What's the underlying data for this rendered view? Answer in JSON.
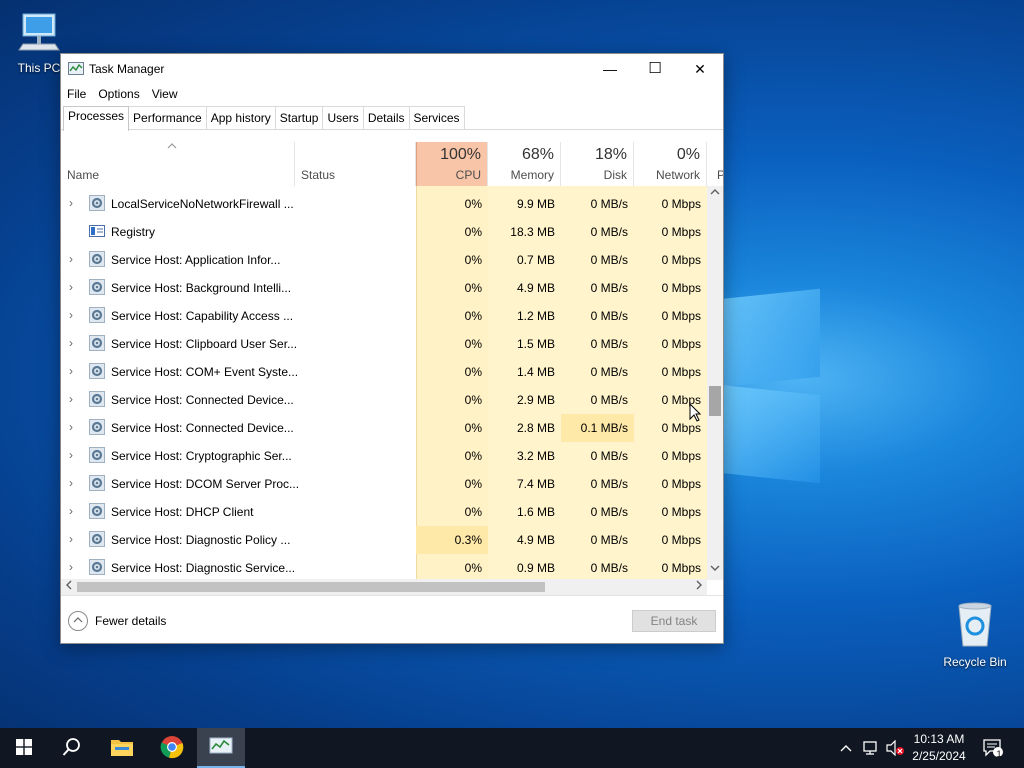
{
  "desktop": {
    "icons": [
      {
        "label": "This PC"
      },
      {
        "label": "Recycle Bin"
      }
    ]
  },
  "window": {
    "title": "Task Manager",
    "controls": {
      "minimize": "—",
      "maximize": "☐",
      "close": "✕"
    }
  },
  "menu": [
    "File",
    "Options",
    "View"
  ],
  "tabs": [
    "Processes",
    "Performance",
    "App history",
    "Startup",
    "Users",
    "Details",
    "Services"
  ],
  "active_tab": "Processes",
  "columns": {
    "name": "Name",
    "status": "Status",
    "cpu": {
      "label": "CPU",
      "pct": "100%"
    },
    "memory": {
      "label": "Memory",
      "pct": "68%"
    },
    "disk": {
      "label": "Disk",
      "pct": "18%"
    },
    "network": {
      "label": "Network",
      "pct": "0%"
    },
    "next": "P"
  },
  "rows": [
    {
      "expand": "›",
      "icon": "gear-icon",
      "name": "LocalServiceNoNetworkFirewall ...",
      "cpu": "0%",
      "mem": "9.9 MB",
      "disk": "0 MB/s",
      "net": "0 Mbps"
    },
    {
      "expand": "",
      "icon": "registry-icon",
      "name": "Registry",
      "cpu": "0%",
      "mem": "18.3 MB",
      "disk": "0 MB/s",
      "net": "0 Mbps"
    },
    {
      "expand": "›",
      "icon": "gear-icon",
      "name": "Service Host: Application Infor...",
      "cpu": "0%",
      "mem": "0.7 MB",
      "disk": "0 MB/s",
      "net": "0 Mbps"
    },
    {
      "expand": "›",
      "icon": "gear-icon",
      "name": "Service Host: Background Intelli...",
      "cpu": "0%",
      "mem": "4.9 MB",
      "disk": "0 MB/s",
      "net": "0 Mbps"
    },
    {
      "expand": "›",
      "icon": "gear-icon",
      "name": "Service Host: Capability Access ...",
      "cpu": "0%",
      "mem": "1.2 MB",
      "disk": "0 MB/s",
      "net": "0 Mbps"
    },
    {
      "expand": "›",
      "icon": "gear-icon",
      "name": "Service Host: Clipboard User Ser...",
      "cpu": "0%",
      "mem": "1.5 MB",
      "disk": "0 MB/s",
      "net": "0 Mbps"
    },
    {
      "expand": "›",
      "icon": "gear-icon",
      "name": "Service Host: COM+ Event Syste...",
      "cpu": "0%",
      "mem": "1.4 MB",
      "disk": "0 MB/s",
      "net": "0 Mbps"
    },
    {
      "expand": "›",
      "icon": "gear-icon",
      "name": "Service Host: Connected Device...",
      "cpu": "0%",
      "mem": "2.9 MB",
      "disk": "0 MB/s",
      "net": "0 Mbps"
    },
    {
      "expand": "›",
      "icon": "gear-icon",
      "name": "Service Host: Connected Device...",
      "cpu": "0%",
      "mem": "2.8 MB",
      "disk": "0.1 MB/s",
      "net": "0 Mbps",
      "disk_hot": true
    },
    {
      "expand": "›",
      "icon": "gear-icon",
      "name": "Service Host: Cryptographic Ser...",
      "cpu": "0%",
      "mem": "3.2 MB",
      "disk": "0 MB/s",
      "net": "0 Mbps"
    },
    {
      "expand": "›",
      "icon": "gear-icon",
      "name": "Service Host: DCOM Server Proc...",
      "cpu": "0%",
      "mem": "7.4 MB",
      "disk": "0 MB/s",
      "net": "0 Mbps"
    },
    {
      "expand": "›",
      "icon": "gear-icon",
      "name": "Service Host: DHCP Client",
      "cpu": "0%",
      "mem": "1.6 MB",
      "disk": "0 MB/s",
      "net": "0 Mbps"
    },
    {
      "expand": "›",
      "icon": "gear-icon",
      "name": "Service Host: Diagnostic Policy ...",
      "cpu": "0.3%",
      "mem": "4.9 MB",
      "disk": "0 MB/s",
      "net": "0 Mbps",
      "cpu_hot": true
    },
    {
      "expand": "›",
      "icon": "gear-icon",
      "name": "Service Host: Diagnostic Service...",
      "cpu": "0%",
      "mem": "0.9 MB",
      "disk": "0 MB/s",
      "net": "0 Mbps"
    }
  ],
  "footer": {
    "fewer_details": "Fewer details",
    "end_task": "End task"
  },
  "taskbar": {
    "pinned": [
      "start-icon",
      "search-icon",
      "file-explorer-icon",
      "chrome-icon",
      "task-manager-icon"
    ],
    "clock": {
      "time": "10:13 AM",
      "date": "2/25/2024"
    },
    "notification_count": "1"
  },
  "colors": {
    "cpu_header": "#f9c5a8",
    "cell_heat": "#fff4cc",
    "hot_cell": "#ffe9a8",
    "taskbar": "#101722"
  }
}
